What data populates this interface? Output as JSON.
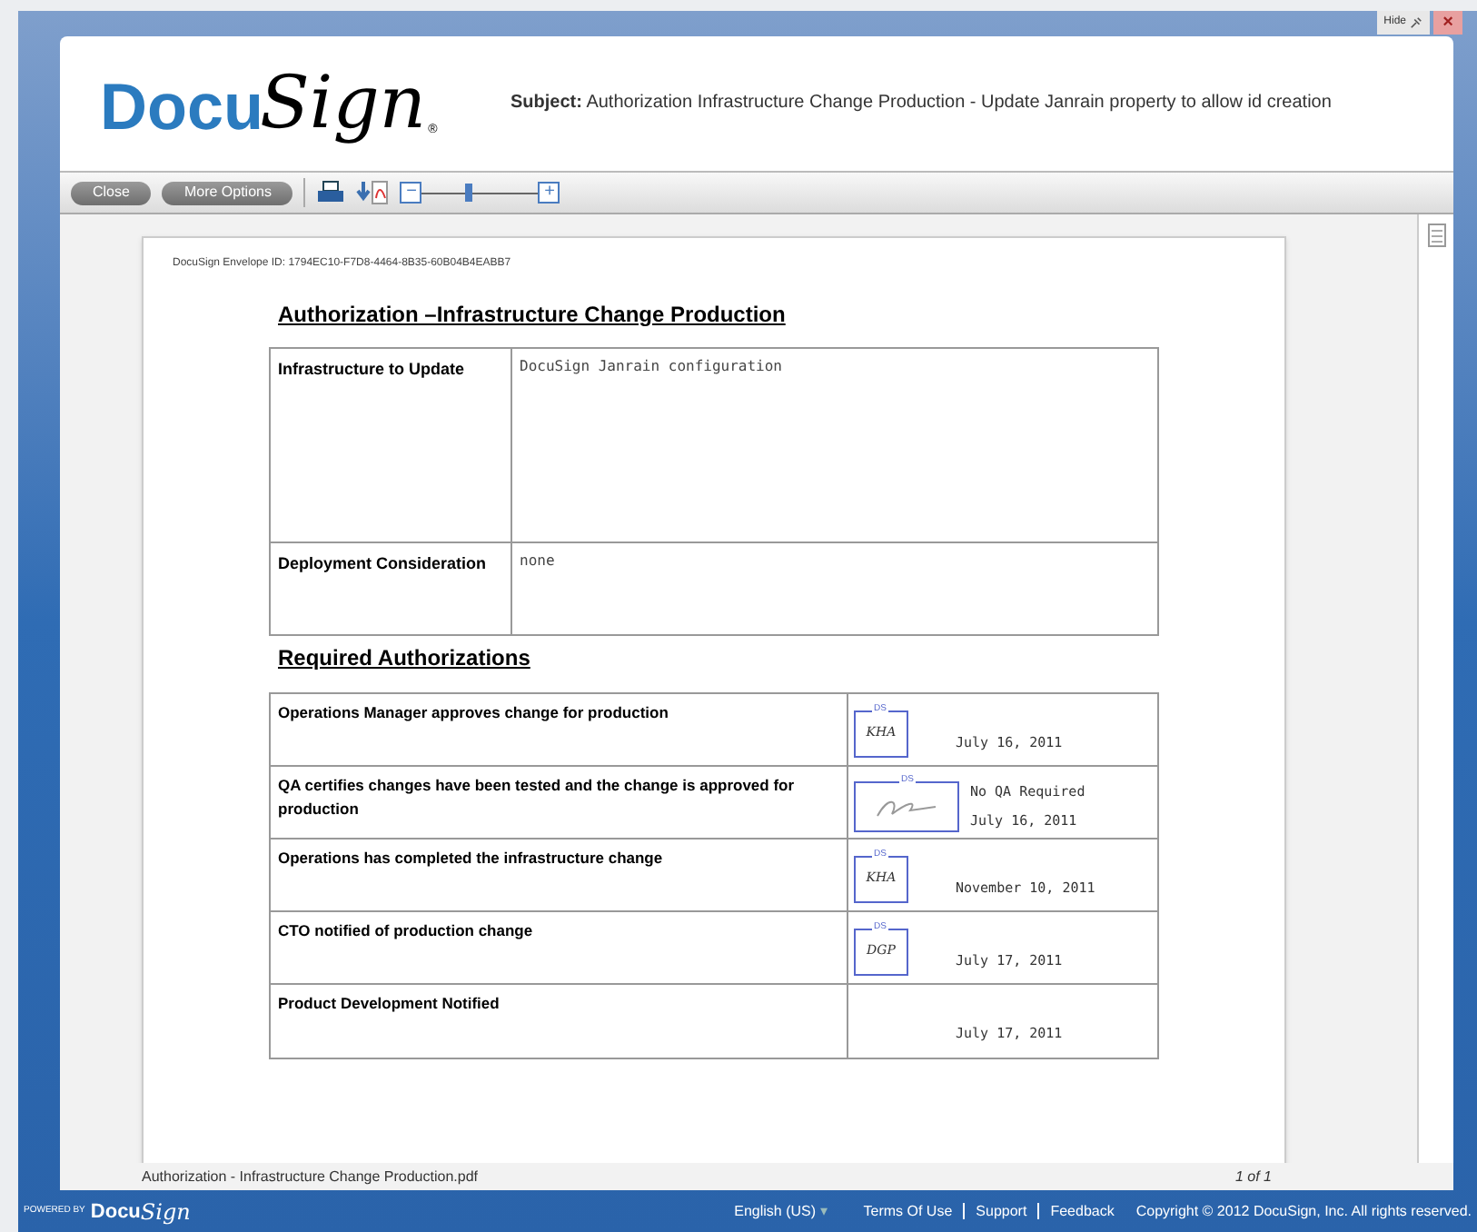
{
  "window_controls": {
    "hide": "Hide",
    "close": "×"
  },
  "header": {
    "logo_prefix": "Docu",
    "logo_script": "Sign",
    "logo_mark": "®",
    "subject_label": "Subject:",
    "subject": "Authorization Infrastructure Change Production - Update Janrain property to allow id creation"
  },
  "toolbar": {
    "buttons": [
      "Close",
      "More Options"
    ],
    "zoom_minus": "−",
    "zoom_plus": "+",
    "zoom": {
      "level": 0.4
    }
  },
  "document": {
    "envelope_id": "DocuSign Envelope ID: 1794EC10-F7D8-4464-8B35-60B04B4EABB7",
    "title": "Authorization –Infrastructure Change Production",
    "details": [
      {
        "label": "Infrastructure to Update",
        "value": "DocuSign Janrain configuration"
      },
      {
        "label": "Deployment Consideration",
        "value": "none"
      }
    ],
    "authorizations_title": "Required Authorizations",
    "authorizations": [
      {
        "task": "Operations Manager approves change for production",
        "stamp": {
          "kind": "initials",
          "tag": "DS",
          "text": "KHA"
        },
        "date": "July 16, 2011"
      },
      {
        "task": "QA certifies changes have been tested and the change is approved for production",
        "stamp": {
          "kind": "signature",
          "tag": "DS"
        },
        "note": "No QA Required",
        "date": "July 16, 2011"
      },
      {
        "task": "Operations has completed the infrastructure change",
        "stamp": {
          "kind": "initials",
          "tag": "DS",
          "text": "KHA"
        },
        "date": "November 10, 2011"
      },
      {
        "task": "CTO notified of production change",
        "stamp": {
          "kind": "initials",
          "tag": "DS",
          "text": "DGP"
        },
        "date": "July 17, 2011"
      },
      {
        "task": "Product Development Notified",
        "date": "July 17, 2011"
      }
    ]
  },
  "file_bar": {
    "filename": "Authorization - Infrastructure Change Production.pdf",
    "page": "1 of 1"
  },
  "footer": {
    "powered_by": "POWERED BY",
    "logo_prefix": "Docu",
    "logo_script": "Sign",
    "language": "English (US)",
    "language_caret": "▾",
    "links": [
      "Terms Of Use",
      "Support",
      "Feedback"
    ],
    "copyright": "Copyright © 2012 DocuSign, Inc. All rights reserved."
  }
}
